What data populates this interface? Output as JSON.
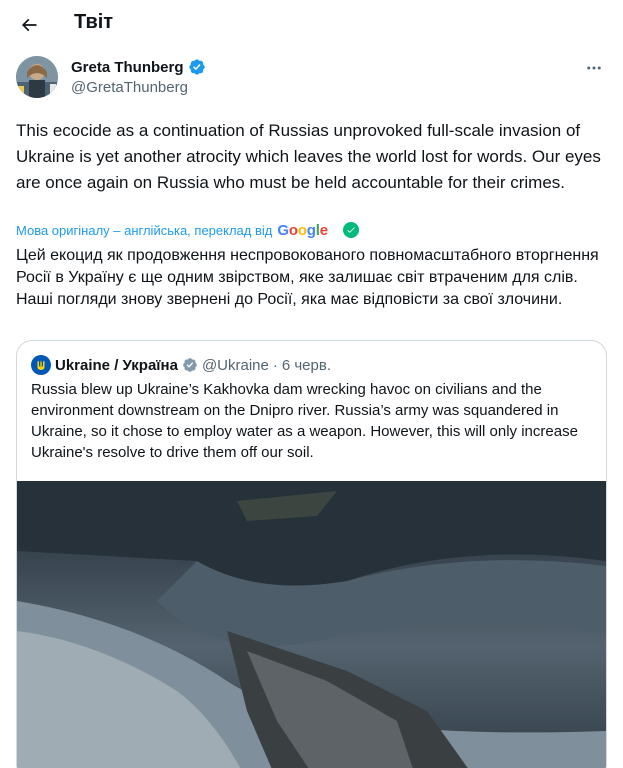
{
  "header": {
    "title": "Твіт"
  },
  "author": {
    "name": "Greta Thunberg",
    "handle": "@GretaThunberg",
    "verified": true
  },
  "tweet": {
    "text": "This ecocide as a continuation of Russias unprovoked full-scale invasion of Ukraine is yet another atrocity which leaves the world lost for words. Our eyes are once again on Russia who must be held accountable for their crimes."
  },
  "translation": {
    "label": "Мова оригіналу – англійська, переклад від",
    "provider": "Google",
    "text": "Цей екоцид як продовження неспровокованого повномасштабного вторгнення Росії в Україну є ще одним звірством, яке залишає світ втраченим для слів. Наші погляди знову звернені до Росії, яка має відповісти за свої злочини."
  },
  "quote": {
    "name": "Ukraine / Україна",
    "handle": "@Ukraine",
    "separator": "·",
    "date": "6 черв.",
    "text": "Russia blew up Ukraine’s Kakhovka dam wrecking havoc on civilians and the environment downstream on the Dnipro river. Russia’s army was squandered in Ukraine, so it chose to employ water as a weapon. However, this will only increase Ukraine's resolve to drive them off our soil."
  },
  "colors": {
    "accent": "#1d9bf0",
    "verified": "#1d9bf0",
    "check": "#00ba7c",
    "muted": "#536471"
  },
  "icons": [
    "back-arrow-icon",
    "verified-badge-icon",
    "more-icon",
    "check-icon",
    "trident-icon"
  ]
}
